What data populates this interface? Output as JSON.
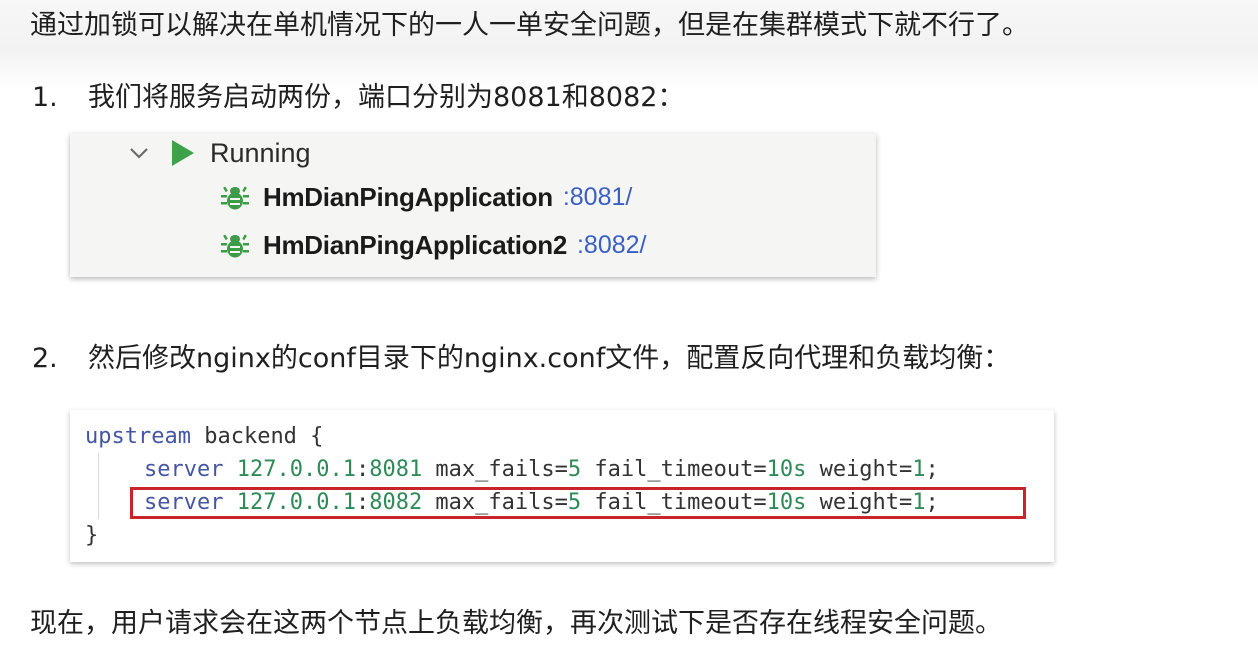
{
  "intro": "通过加锁可以解决在单机情况下的一人一单安全问题，但是在集群模式下就不行了。",
  "steps": [
    {
      "number": "1.",
      "text": "我们将服务启动两份，端口分别为8081和8082："
    },
    {
      "number": "2.",
      "text": "然后修改nginx的conf目录下的nginx.conf文件，配置反向代理和负载均衡："
    }
  ],
  "run_panel": {
    "group_label": "Running",
    "icons": {
      "expand": "chevron-down-icon",
      "run": "play-icon",
      "app": "bug-icon"
    },
    "apps": [
      {
        "name": "HmDianPingApplication",
        "port": ":8081/"
      },
      {
        "name": "HmDianPingApplication2",
        "port": ":8082/"
      }
    ]
  },
  "code": {
    "line1": {
      "kw": "upstream",
      "rest": " backend {"
    },
    "servers": [
      {
        "kw": "server",
        "ip": "127.0.0.1",
        "port": "8081",
        "mid": " max_fails=",
        "max_fails": "5",
        "ft": " fail_timeout=",
        "timeout": "10s",
        "w": " weight=",
        "weight": "1",
        "end": ";"
      },
      {
        "kw": "server",
        "ip": "127.0.0.1",
        "port": "8082",
        "mid": " max_fails=",
        "max_fails": "5",
        "ft": " fail_timeout=",
        "timeout": "10s",
        "w": " weight=",
        "weight": "1",
        "end": ";"
      }
    ],
    "closing": "}",
    "highlight_color": "#c9232c"
  },
  "outro": "现在，用户请求会在这两个节点上负载均衡，再次测试下是否存在线程安全问题。"
}
